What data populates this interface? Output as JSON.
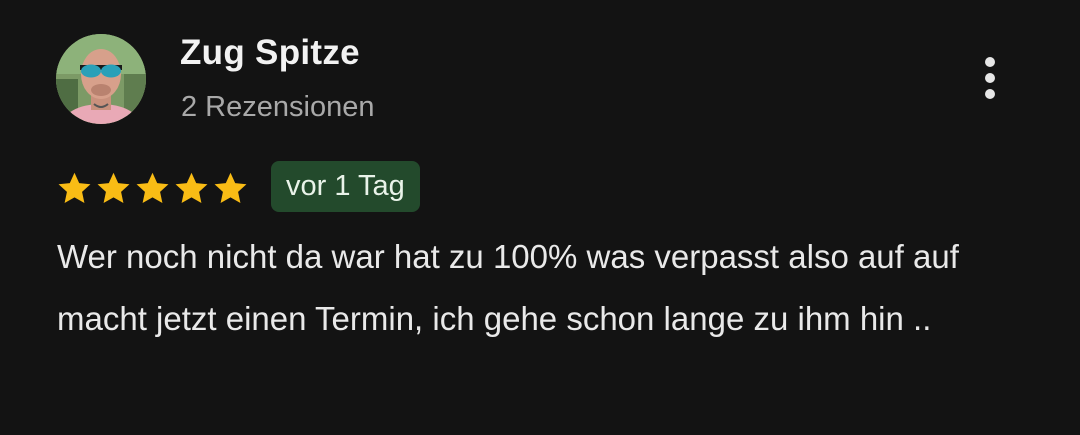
{
  "review": {
    "author": {
      "name": "Zug Spitze",
      "review_count_label": "2 Rezensionen",
      "avatar_icon": "profile-photo"
    },
    "rating": {
      "stars": 5,
      "max": 5,
      "star_color": "#f9bc15"
    },
    "date_label": "vor 1 Tag",
    "text": "Wer noch nicht da war hat zu 100% was verpasst also auf auf macht jetzt einen Termin, ich gehe schon lange zu ihm hin ..",
    "more_icon": "more-vert-icon"
  },
  "colors": {
    "background": "#131313",
    "chip_background": "#234a2c"
  }
}
